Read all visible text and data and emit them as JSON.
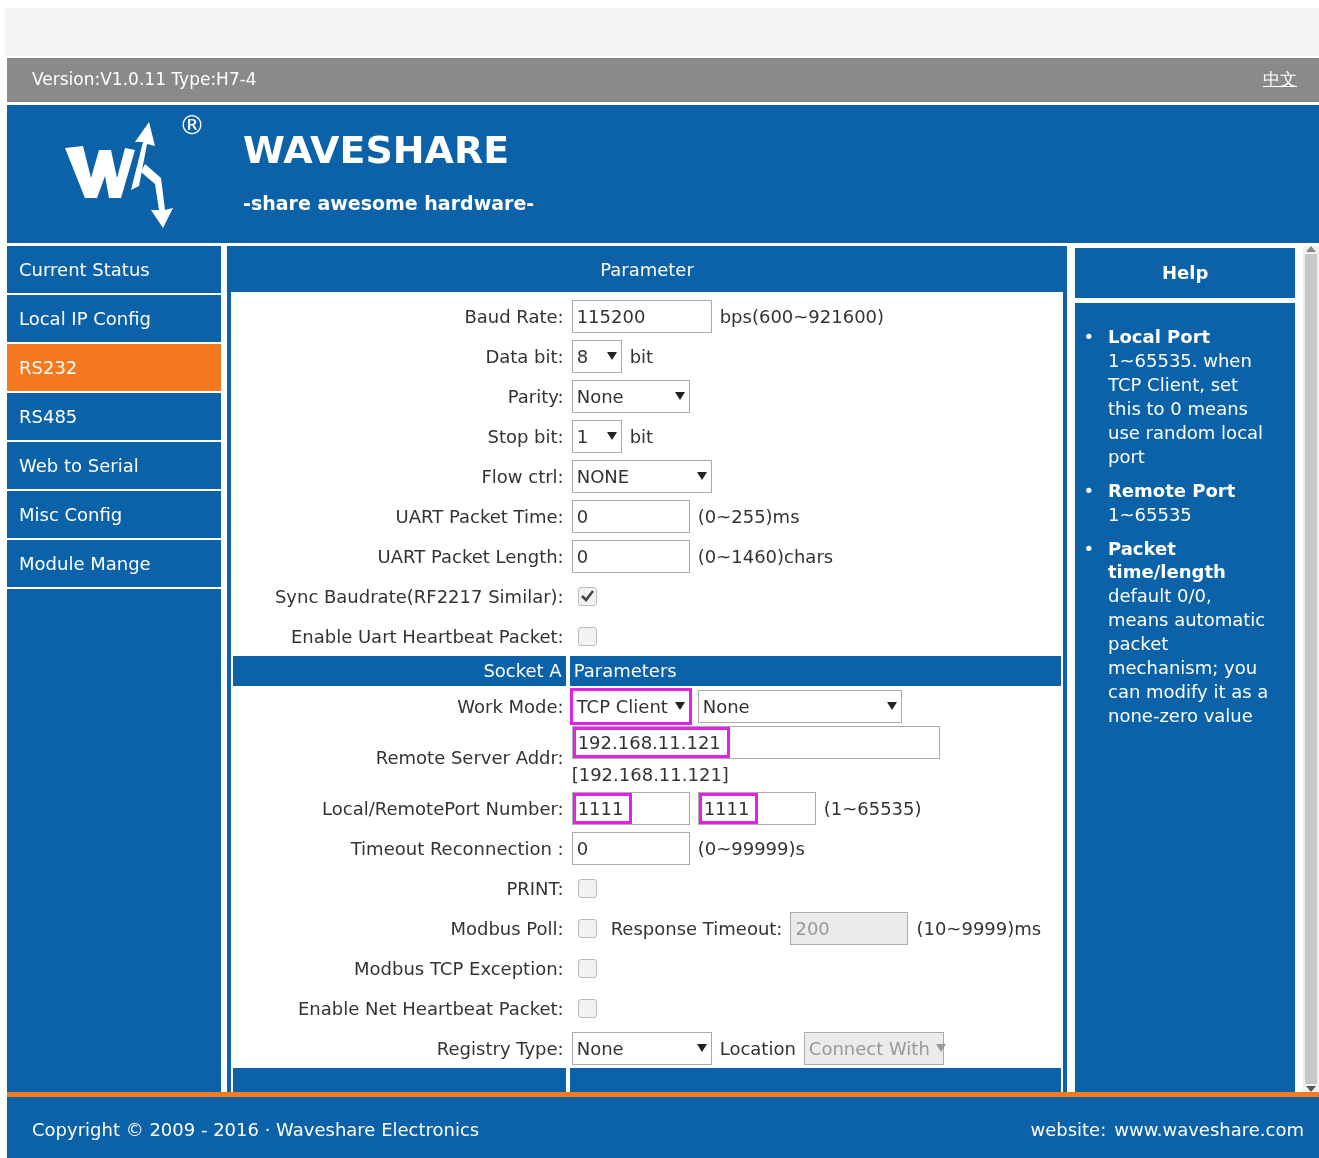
{
  "top_bar": {
    "version": "Version:V1.0.11 Type:H7-4",
    "language_link": "中文"
  },
  "header": {
    "brand": "WAVESHARE",
    "registered_mark": "®",
    "tagline": "-share awesome hardware-"
  },
  "sidebar": {
    "items": [
      {
        "label": "Current Status",
        "selected": false
      },
      {
        "label": "Local IP Config",
        "selected": false
      },
      {
        "label": "RS232",
        "selected": true
      },
      {
        "label": "RS485",
        "selected": false
      },
      {
        "label": "Web to Serial",
        "selected": false
      },
      {
        "label": "Misc Config",
        "selected": false
      },
      {
        "label": "Module Mange",
        "selected": false
      }
    ]
  },
  "parameter_panel": {
    "title": "Parameter",
    "rows": [
      {
        "kind": "field",
        "label": "Baud Rate:",
        "controls": [
          {
            "kind": "wideinput",
            "value": "115200"
          },
          {
            "kind": "note",
            "text": "bps(600~921600)"
          }
        ]
      },
      {
        "kind": "field",
        "label": "Data bit:",
        "controls": [
          {
            "kind": "tinyselect",
            "value": "8"
          },
          {
            "kind": "note",
            "text": "bit"
          }
        ]
      },
      {
        "kind": "field",
        "label": "Parity:",
        "controls": [
          {
            "kind": "select",
            "value": "None"
          }
        ]
      },
      {
        "kind": "field",
        "label": "Stop bit:",
        "controls": [
          {
            "kind": "tinyselect",
            "value": "1"
          },
          {
            "kind": "note",
            "text": "bit"
          }
        ]
      },
      {
        "kind": "field",
        "label": "Flow ctrl:",
        "controls": [
          {
            "kind": "wideselect",
            "value": "NONE"
          }
        ]
      },
      {
        "kind": "field",
        "label": "UART Packet Time:",
        "controls": [
          {
            "kind": "input",
            "value": "0"
          },
          {
            "kind": "note",
            "text": "(0~255)ms"
          }
        ]
      },
      {
        "kind": "field",
        "label": "UART Packet Length:",
        "controls": [
          {
            "kind": "input",
            "value": "0"
          },
          {
            "kind": "note",
            "text": "(0~1460)chars"
          }
        ]
      },
      {
        "kind": "field",
        "label": "Sync Baudrate(RF2217 Similar):",
        "controls": [
          {
            "kind": "checkbox",
            "checked": true
          }
        ]
      },
      {
        "kind": "field",
        "label": "Enable Uart Heartbeat Packet:",
        "controls": [
          {
            "kind": "checkbox",
            "checked": false
          }
        ]
      },
      {
        "kind": "section",
        "title_left": "Socket A",
        "title_right": "Parameters"
      },
      {
        "kind": "field",
        "label": "Work Mode:",
        "controls": [
          {
            "kind": "select",
            "value": "TCP Client",
            "highlighted": true
          },
          {
            "kind": "longselect",
            "value": "None"
          }
        ]
      },
      {
        "kind": "field",
        "label": "Remote Server Addr:",
        "controls": [
          {
            "kind": "longinput",
            "value": "192.168.11.121",
            "highlighted": true
          }
        ],
        "sub_note": "[192.168.11.121]"
      },
      {
        "kind": "field",
        "label": "Local/RemotePort Number:",
        "controls": [
          {
            "kind": "input",
            "value": "1111",
            "highlighted": true
          },
          {
            "kind": "input",
            "value": "1111",
            "highlighted": true
          },
          {
            "kind": "note",
            "text": "(1~65535)"
          }
        ]
      },
      {
        "kind": "field",
        "label": "Timeout Reconnection :",
        "controls": [
          {
            "kind": "input",
            "value": "0"
          },
          {
            "kind": "note",
            "text": "(0~99999)s"
          }
        ]
      },
      {
        "kind": "field",
        "label": "PRINT:",
        "controls": [
          {
            "kind": "checkbox",
            "checked": false
          }
        ]
      },
      {
        "kind": "field",
        "label": "Modbus Poll:",
        "controls": [
          {
            "kind": "checkbox",
            "checked": false
          },
          {
            "kind": "note",
            "text": "Response Timeout:"
          },
          {
            "kind": "input",
            "value": "200",
            "disabled": true
          },
          {
            "kind": "note",
            "text": "(10~9999)ms"
          }
        ]
      },
      {
        "kind": "field",
        "label": "Modbus TCP Exception:",
        "controls": [
          {
            "kind": "checkbox",
            "checked": false
          }
        ]
      },
      {
        "kind": "field",
        "label": "Enable Net Heartbeat Packet:",
        "controls": [
          {
            "kind": "checkbox",
            "checked": false
          }
        ]
      },
      {
        "kind": "field",
        "label": "Registry Type:",
        "controls": [
          {
            "kind": "wideselect",
            "value": "None"
          },
          {
            "kind": "note",
            "text": "Location"
          },
          {
            "kind": "wideselect",
            "value": "Connect With",
            "disabled": true
          }
        ]
      },
      {
        "kind": "section"
      }
    ]
  },
  "help_panel": {
    "title": "Help",
    "items": [
      {
        "bullet": "•",
        "title": "Local Port",
        "text": "1~65535. when TCP Client, set this to 0 means use random local port"
      },
      {
        "bullet": "•",
        "title": "Remote Port",
        "text": "1~65535"
      },
      {
        "bullet": "•",
        "title": "Packet time/length",
        "text": "default 0/0, means automatic packet mechanism; you can modify it as a none-zero value"
      }
    ]
  },
  "footer": {
    "copyright": "Copyright © 2009 - 2016 · Waveshare Electronics",
    "website_label": "website:",
    "website_link": "www.waveshare.com"
  }
}
